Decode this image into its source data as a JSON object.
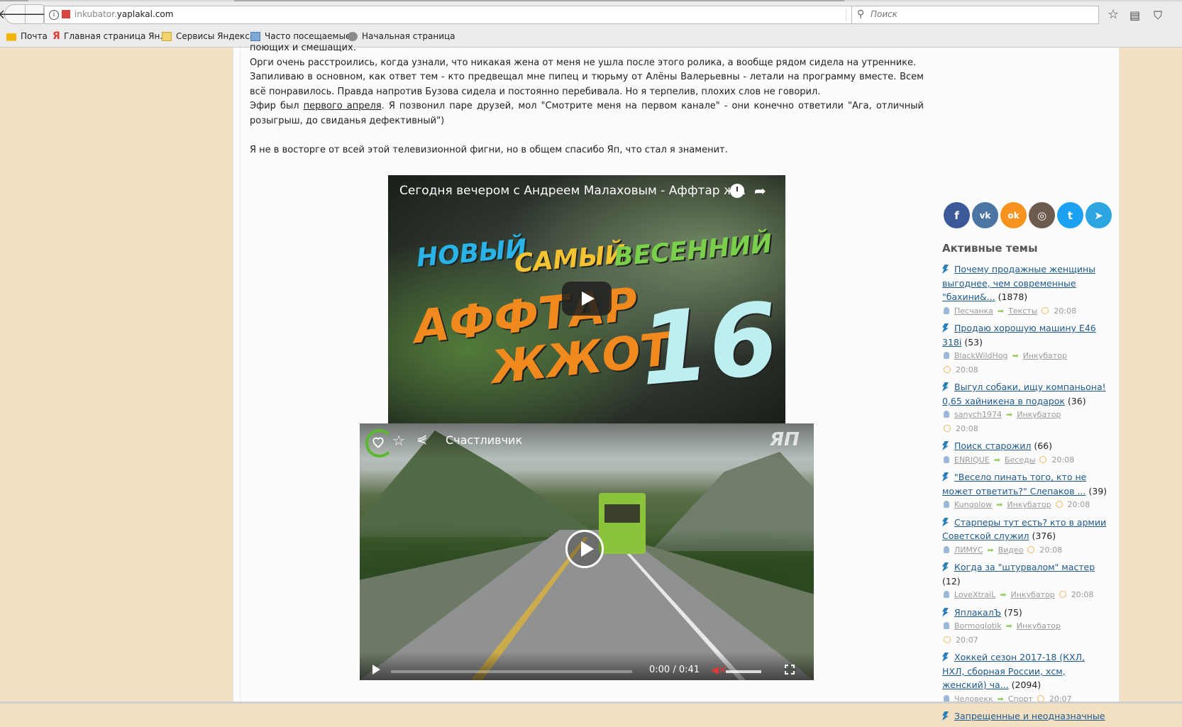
{
  "browser": {
    "url_prefix": "inkubator.",
    "url_domain": "yaplakal.com",
    "search_placeholder": "Поиск",
    "bookmarks": [
      "Почта",
      "Главная страница Ян...",
      "Сервисы Яндекса",
      "Часто посещаемые",
      "Начальная страница"
    ]
  },
  "post": {
    "line0": "поющих и смешащих.",
    "line1": "Орги очень расстроились, когда узнали, что никакая жена от меня не ушла после этого ролика, а вообще рядом сидела на утреннике.",
    "para2": "Запиливаю в основном, как ответ тем - кто предвещал мне пипец и тюрьму от Алёны Валерьевны - летали на программу вместе. Всем всё понравилось. Правда напротив Бузова сидела и постоянно перебивала. Но я терпелив, плохих слов не говорил.",
    "para3_before": "Эфир был ",
    "para3_link": "первого апреля",
    "para3_after": ". Я позвонил паре друзей, мол \"Смотрите меня на первом канале\" - они конечно ответили \"Ага, отличный розыгрыш, до свиданья дефективный\")",
    "para4": "Я не в восторге от всей этой телевизионной фигни, но в общем спасибо Яп, что стал я знаменит."
  },
  "video1": {
    "title": "Сегодня вечером с Андреем Малаховым - Аффтар ж...",
    "thumb_words": [
      "НОВЫЙ",
      "САМЫЙ",
      "ВЕСЕННИЙ",
      "АФФТАР",
      "ЖЖОТ",
      "16"
    ]
  },
  "video2": {
    "title": "Счастливчик",
    "logo": "ЯП",
    "time": "0:00 / 0:41"
  },
  "sidebar": {
    "social": [
      {
        "label": "f",
        "color": "#3b5998"
      },
      {
        "label": "vk",
        "color": "#4c75a3"
      },
      {
        "label": "ok",
        "color": "#f7931e"
      },
      {
        "label": "◎",
        "color": "#6d5b4f"
      },
      {
        "label": "t",
        "color": "#1da1f2"
      },
      {
        "label": "➤",
        "color": "#2ca5e0"
      }
    ],
    "active_title": "Активные темы",
    "topics": [
      {
        "title": "Почему продажные женщины выгоднее, чем современные \"бахини&...",
        "count": "(1878)",
        "user": "Песчанка",
        "section": "Тексты",
        "time": "20:08"
      },
      {
        "title": "Продаю хорошую машину Е46 318i",
        "count": "(53)",
        "user": "BlackWildHog",
        "section": "Инкубатор",
        "time": "20:08"
      },
      {
        "title": "Выгул собаки, ищу компаньона! 0,65 хайникена в подарок",
        "count": "(36)",
        "user": "sanych1974",
        "section": "Инкубатор",
        "time": "20:08"
      },
      {
        "title": "Поиск старожил",
        "count": "(66)",
        "user": "ENRIQUE",
        "section": "Беседы",
        "time": "20:08"
      },
      {
        "title": "\"Весело пинать того, кто не может ответить?\" Слепаков ...",
        "count": "(39)",
        "user": "Kungolow",
        "section": "Инкубатор",
        "time": "20:08"
      },
      {
        "title": "Старперы тут есть? кто в армии Советской служил",
        "count": "(376)",
        "user": "ЛИМУС",
        "section": "Видео",
        "time": "20:08"
      },
      {
        "title": "Когда за \"штурвалом\" мастер",
        "count": "(12)",
        "user": "LoveXtraiL",
        "section": "Инкубатор",
        "time": "20:08"
      },
      {
        "title": "ЯплакалЪ",
        "count": "(75)",
        "user": "Bormoglotik",
        "section": "Инкубатор",
        "time": "20:07"
      },
      {
        "title": "Хоккей сезон 2017-18 (КХЛ, НХЛ, сборная России, хсм, женский) ча...",
        "count": "(2094)",
        "user": "Человекк",
        "section": "Спорт",
        "time": "20:07"
      },
      {
        "title": "Запрещенные и неодназначные",
        "count": "",
        "user": "",
        "section": "",
        "time": ""
      }
    ]
  }
}
